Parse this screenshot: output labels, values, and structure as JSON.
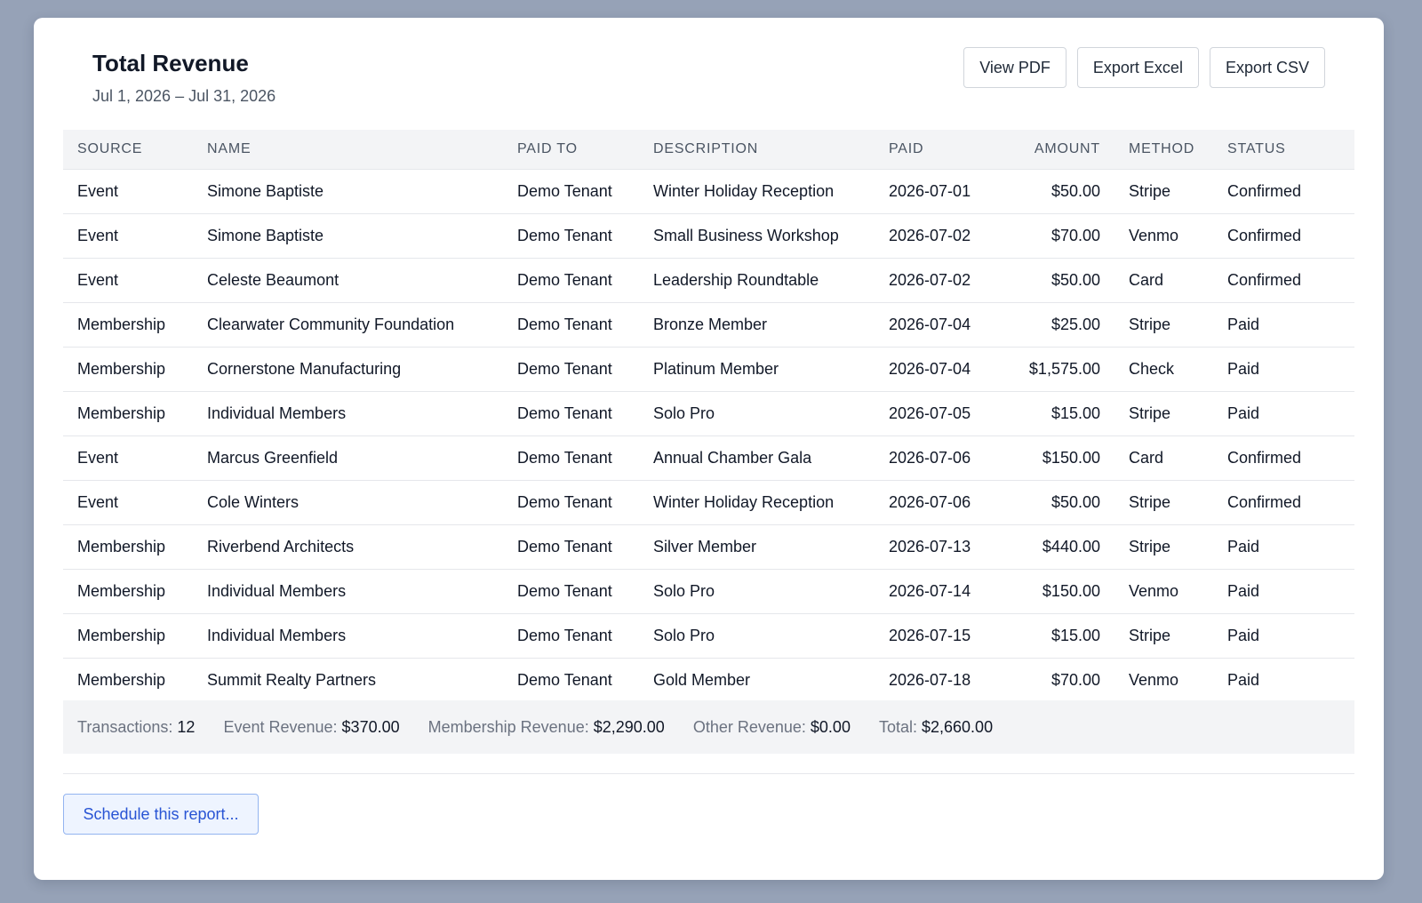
{
  "report": {
    "title": "Total Revenue",
    "date_range": "Jul 1, 2026 – Jul 31, 2026"
  },
  "actions": {
    "view_pdf": "View PDF",
    "export_excel": "Export Excel",
    "export_csv": "Export CSV"
  },
  "table": {
    "columns": [
      "SOURCE",
      "NAME",
      "PAID TO",
      "DESCRIPTION",
      "PAID",
      "AMOUNT",
      "METHOD",
      "STATUS"
    ],
    "rows": [
      [
        "Event",
        "Simone Baptiste",
        "Demo Tenant",
        "Winter Holiday Reception",
        "2026-07-01",
        "$50.00",
        "Stripe",
        "Confirmed"
      ],
      [
        "Event",
        "Simone Baptiste",
        "Demo Tenant",
        "Small Business Workshop",
        "2026-07-02",
        "$70.00",
        "Venmo",
        "Confirmed"
      ],
      [
        "Event",
        "Celeste Beaumont",
        "Demo Tenant",
        "Leadership Roundtable",
        "2026-07-02",
        "$50.00",
        "Card",
        "Confirmed"
      ],
      [
        "Membership",
        "Clearwater Community Foundation",
        "Demo Tenant",
        "Bronze Member",
        "2026-07-04",
        "$25.00",
        "Stripe",
        "Paid"
      ],
      [
        "Membership",
        "Cornerstone Manufacturing",
        "Demo Tenant",
        "Platinum Member",
        "2026-07-04",
        "$1,575.00",
        "Check",
        "Paid"
      ],
      [
        "Membership",
        "Individual Members",
        "Demo Tenant",
        "Solo Pro",
        "2026-07-05",
        "$15.00",
        "Stripe",
        "Paid"
      ],
      [
        "Event",
        "Marcus Greenfield",
        "Demo Tenant",
        "Annual Chamber Gala",
        "2026-07-06",
        "$150.00",
        "Card",
        "Confirmed"
      ],
      [
        "Event",
        "Cole Winters",
        "Demo Tenant",
        "Winter Holiday Reception",
        "2026-07-06",
        "$50.00",
        "Stripe",
        "Confirmed"
      ],
      [
        "Membership",
        "Riverbend Architects",
        "Demo Tenant",
        "Silver Member",
        "2026-07-13",
        "$440.00",
        "Stripe",
        "Paid"
      ],
      [
        "Membership",
        "Individual Members",
        "Demo Tenant",
        "Solo Pro",
        "2026-07-14",
        "$150.00",
        "Venmo",
        "Paid"
      ],
      [
        "Membership",
        "Individual Members",
        "Demo Tenant",
        "Solo Pro",
        "2026-07-15",
        "$15.00",
        "Stripe",
        "Paid"
      ],
      [
        "Membership",
        "Summit Realty Partners",
        "Demo Tenant",
        "Gold Member",
        "2026-07-18",
        "$70.00",
        "Venmo",
        "Paid"
      ]
    ]
  },
  "summary": {
    "transactions_label": "Transactions:",
    "transactions_value": "12",
    "event_label": "Event Revenue:",
    "event_value": "$370.00",
    "membership_label": "Membership Revenue:",
    "membership_value": "$2,290.00",
    "other_label": "Other Revenue:",
    "other_value": "$0.00",
    "total_label": "Total:",
    "total_value": "$2,660.00"
  },
  "schedule": {
    "label": "Schedule this report..."
  },
  "colors": {
    "page_background": "#96a2b7",
    "card_background": "#ffffff",
    "header_background": "#f3f4f6",
    "accent": "#2854d4"
  }
}
